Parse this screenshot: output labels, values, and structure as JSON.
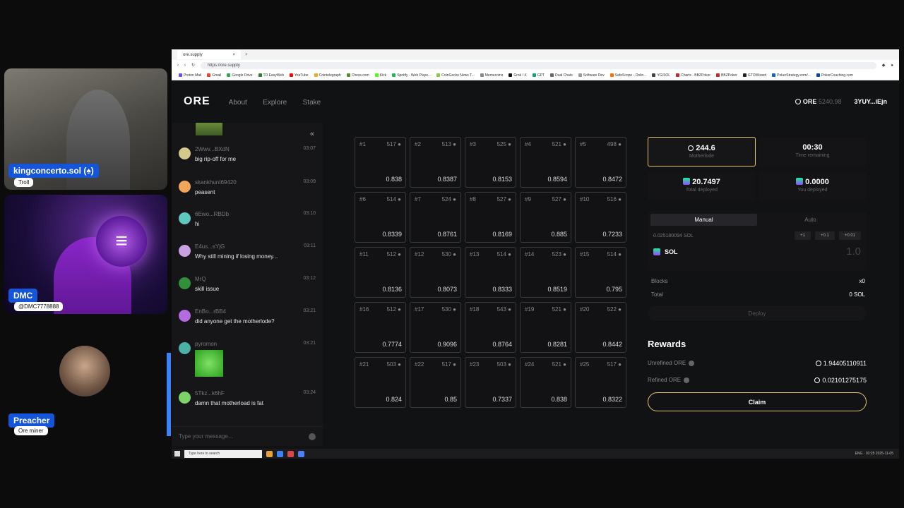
{
  "streamers": [
    {
      "name": "kingconcerto.sol (♠)",
      "tag": "Troll"
    },
    {
      "name": "DMC",
      "tag": "@DMC7778888"
    },
    {
      "name": "Preacher",
      "tag": "Ore miner"
    }
  ],
  "browser": {
    "tab_title": "ore.supply",
    "url": "https://ore.supply",
    "bookmarks": [
      "Proton Mail",
      "Gmail",
      "Google Drive",
      "TD EasyWeb",
      "YouTube",
      "Cointelegraph",
      "Chess.com",
      "Kick",
      "Spotify - Web Playe...",
      "CoinGecko News T...",
      "Memecoins",
      "Grok / X",
      "GPT",
      "Dual Chats",
      "Software Dev",
      "SafeScope - Onlin...",
      "YG/SOL",
      "Charts - BBZPoker",
      "BBZPoker",
      "GTOWizard",
      "PokerStrategy.com/...",
      "PokerCoaching.com"
    ]
  },
  "header": {
    "logo": "ORE",
    "nav": [
      "About",
      "Explore",
      "Stake"
    ],
    "ore_label": "ORE",
    "ore_balance": "5240.98",
    "wallet": "3YUY...iEjn"
  },
  "chat": {
    "placeholder": "Type your message...",
    "messages": [
      {
        "user": "2Wwv...BXdN",
        "time": "03:07",
        "text": "big rip-off for me",
        "color": "#d4c98a"
      },
      {
        "user": "skankhunt69420",
        "time": "03:09",
        "text": "peasent",
        "color": "#f2a65a"
      },
      {
        "user": "6Ewo...RBDb",
        "time": "03:10",
        "text": "hi",
        "color": "#5ec8c0"
      },
      {
        "user": "E4us...sYjG",
        "time": "03:11",
        "text": "Why still mining if losing money...",
        "color": "#c9a0e0"
      },
      {
        "user": "MrQ",
        "time": "03:12",
        "text": "skill issue",
        "color": "#2f8f3a"
      },
      {
        "user": "EnBo...rBB4",
        "time": "03:21",
        "text": "did anyone get the motherlode?",
        "color": "#b56be0"
      },
      {
        "user": "pyromon",
        "time": "03:21",
        "text": "",
        "color": "#4bb0a6"
      },
      {
        "user": "5Tkz...k6hF",
        "time": "03:24",
        "text": "damn that motherload is fat",
        "color": "#7bd36a"
      }
    ]
  },
  "grid": [
    {
      "id": "#1",
      "miners": "517",
      "value": "0.838"
    },
    {
      "id": "#2",
      "miners": "513",
      "value": "0.8387"
    },
    {
      "id": "#3",
      "miners": "525",
      "value": "0.8153"
    },
    {
      "id": "#4",
      "miners": "521",
      "value": "0.8594"
    },
    {
      "id": "#5",
      "miners": "498",
      "value": "0.8472"
    },
    {
      "id": "#6",
      "miners": "514",
      "value": "0.8339"
    },
    {
      "id": "#7",
      "miners": "524",
      "value": "0.8761"
    },
    {
      "id": "#8",
      "miners": "527",
      "value": "0.8169"
    },
    {
      "id": "#9",
      "miners": "527",
      "value": "0.885"
    },
    {
      "id": "#10",
      "miners": "516",
      "value": "0.7233"
    },
    {
      "id": "#11",
      "miners": "512",
      "value": "0.8136"
    },
    {
      "id": "#12",
      "miners": "530",
      "value": "0.8073"
    },
    {
      "id": "#13",
      "miners": "514",
      "value": "0.8333"
    },
    {
      "id": "#14",
      "miners": "523",
      "value": "0.8519"
    },
    {
      "id": "#15",
      "miners": "514",
      "value": "0.795"
    },
    {
      "id": "#16",
      "miners": "512",
      "value": "0.7774"
    },
    {
      "id": "#17",
      "miners": "530",
      "value": "0.9096"
    },
    {
      "id": "#18",
      "miners": "543",
      "value": "0.8764"
    },
    {
      "id": "#19",
      "miners": "521",
      "value": "0.8281"
    },
    {
      "id": "#20",
      "miners": "522",
      "value": "0.8442"
    },
    {
      "id": "#21",
      "miners": "503",
      "value": "0.824"
    },
    {
      "id": "#22",
      "miners": "517",
      "value": "0.85"
    },
    {
      "id": "#23",
      "miners": "503",
      "value": "0.7337"
    },
    {
      "id": "#24",
      "miners": "521",
      "value": "0.838"
    },
    {
      "id": "#25",
      "miners": "517",
      "value": "0.8322"
    }
  ],
  "panel": {
    "motherlode_value": "244.6",
    "motherlode_label": "Motherlode",
    "timer_value": "00:30",
    "timer_label": "Time remaining",
    "total_deployed_value": "20.7497",
    "total_deployed_label": "Total deployed",
    "you_deployed_value": "0.0000",
    "you_deployed_label": "You deployed",
    "modes": [
      "Manual",
      "Auto"
    ],
    "balance": "0.025180094 SOL",
    "amount_buttons": [
      "+1",
      "+0.1",
      "+0.01"
    ],
    "token": "SOL",
    "amount_placeholder": "1.0",
    "blocks_label": "Blocks",
    "blocks_value": "x0",
    "total_label": "Total",
    "total_value": "0 SOL",
    "deploy_label": "Deploy",
    "rewards_title": "Rewards",
    "unrefined_label": "Unrefined ORE",
    "unrefined_value": "1.94405110911",
    "refined_label": "Refined ORE",
    "refined_value": "0.02101275175",
    "claim_label": "Claim"
  },
  "taskbar": {
    "search_placeholder": "Type here to search",
    "clock": "03:25 2025-11-05",
    "lang": "ENG"
  },
  "colors": {
    "accent_gold": "#e3c46b",
    "badge_blue": "#1455d9",
    "bg": "#111214"
  }
}
